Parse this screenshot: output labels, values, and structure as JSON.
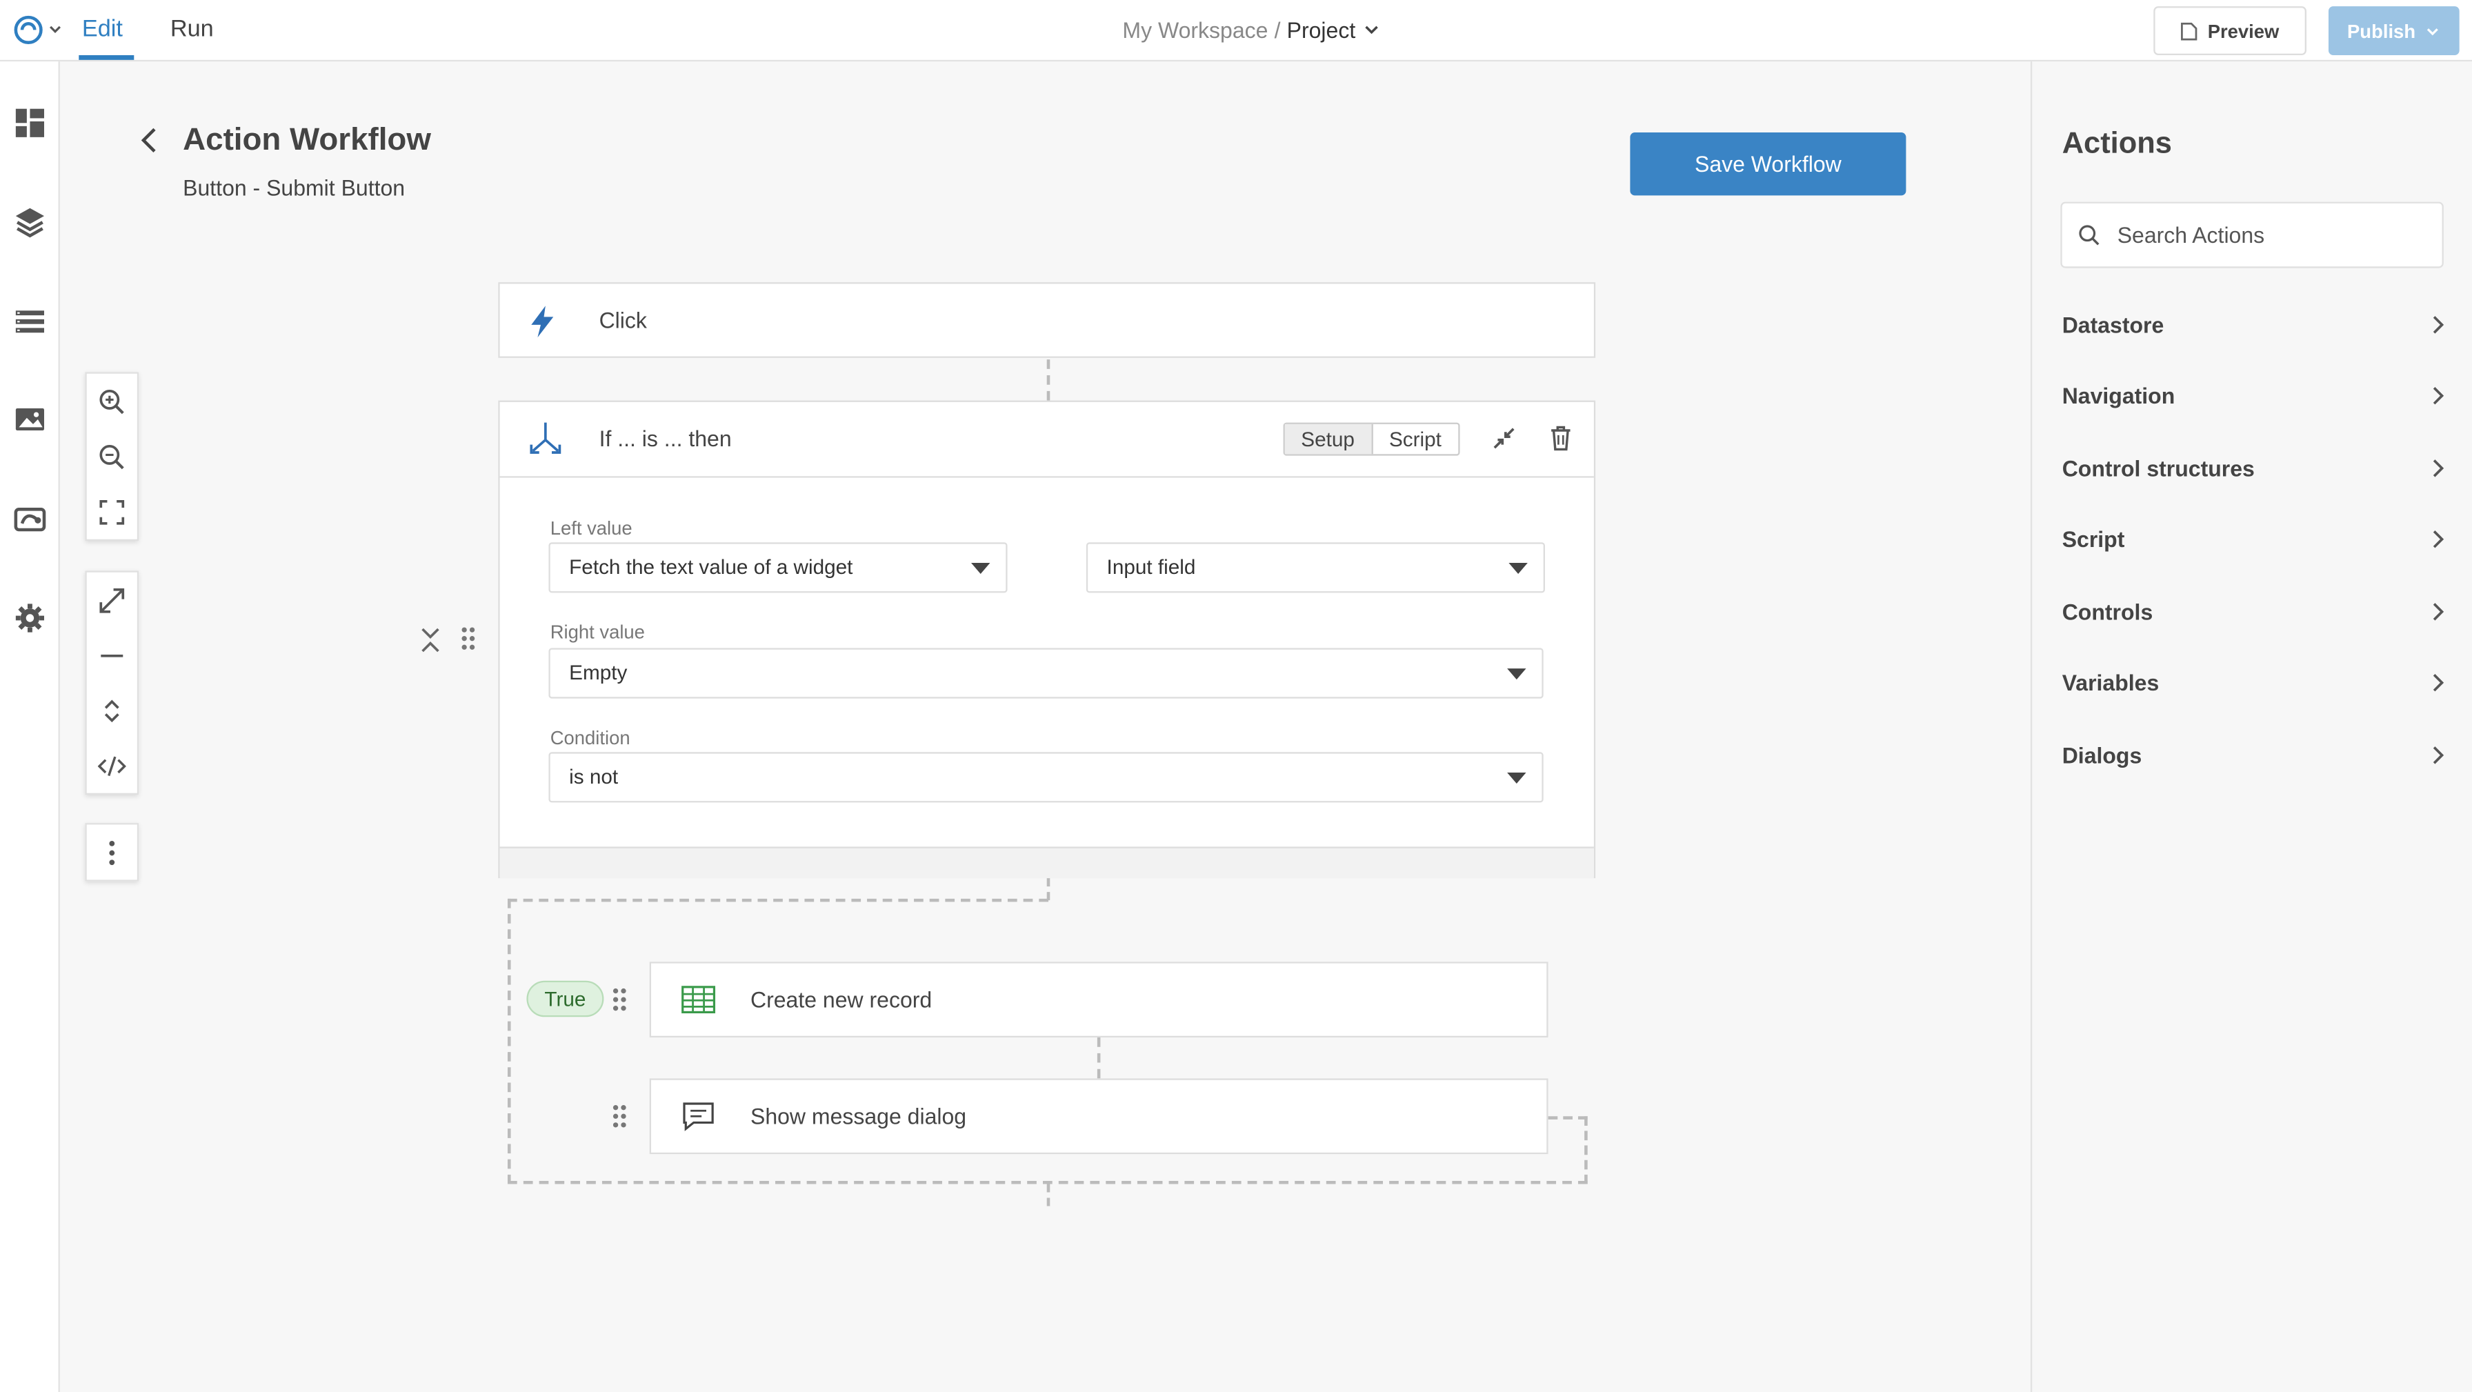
{
  "topbar": {
    "tabs": [
      {
        "label": "Edit",
        "active": true
      },
      {
        "label": "Run",
        "active": false
      }
    ],
    "breadcrumb": {
      "workspace": "My Workspace",
      "separator": "/",
      "project": "Project"
    },
    "preview_label": "Preview",
    "publish_label": "Publish"
  },
  "header": {
    "title": "Action Workflow",
    "subtitle": "Button - Submit Button",
    "save_label": "Save Workflow"
  },
  "workflow": {
    "trigger": {
      "label": "Click",
      "icon": "lightning-icon"
    },
    "condition": {
      "label": "If ... is ... then",
      "tabs": [
        "Setup",
        "Script"
      ],
      "active_tab": "Setup",
      "left_value_label": "Left value",
      "left_value_source": "Fetch the text value of a widget",
      "left_value_widget": "Input field",
      "right_value_label": "Right value",
      "right_value": "Empty",
      "condition_label": "Condition",
      "condition_value": "is not"
    },
    "branch_label": "True",
    "actions": [
      {
        "label": "Create new record",
        "icon": "table-icon"
      },
      {
        "label": "Show message dialog",
        "icon": "message-icon"
      }
    ]
  },
  "actions_panel": {
    "title": "Actions",
    "search_placeholder": "Search Actions",
    "categories": [
      "Datastore",
      "Navigation",
      "Control structures",
      "Script",
      "Controls",
      "Variables",
      "Dialogs"
    ]
  },
  "colors": {
    "accent": "#2f7fc1",
    "save_button": "#3a84c5",
    "publish_button": "#9cc4e4",
    "true_badge_bg": "#dff1df",
    "table_icon": "#3a9a4a",
    "lightning_icon": "#2f6fb5"
  }
}
